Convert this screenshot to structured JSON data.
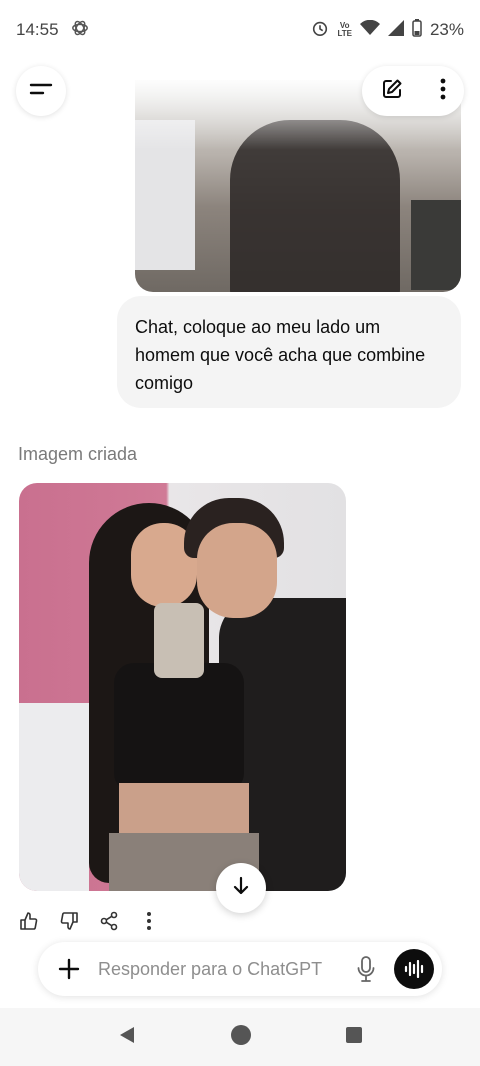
{
  "status_bar": {
    "time": "14:55",
    "network_label_top": "Vo",
    "network_label_bottom": "LTE",
    "battery": "23%",
    "icons": [
      "chatgpt-logo-icon",
      "alarm-icon",
      "wifi-icon",
      "signal-icon",
      "battery-icon"
    ]
  },
  "header": {
    "icons": [
      "menu-icon",
      "new-chat-icon",
      "more-vertical-icon"
    ]
  },
  "conversation": {
    "user_message": "Chat, coloque ao meu lado um homem que você acha que combine comigo",
    "image_caption": "Imagem criada"
  },
  "message_actions": {
    "icons": [
      "thumbs-up-icon",
      "thumbs-down-icon",
      "share-icon",
      "more-vertical-icon"
    ]
  },
  "composer": {
    "placeholder": "Responder para o ChatGPT",
    "icons": [
      "plus-icon",
      "mic-icon",
      "voice-mode-icon"
    ]
  },
  "nav_bar": {
    "icons": [
      "back-icon",
      "home-icon",
      "recents-icon"
    ]
  },
  "colors": {
    "bubble_bg": "#f4f4f4",
    "caption": "#7a7a7a",
    "voice_button": "#0d0d0d"
  }
}
